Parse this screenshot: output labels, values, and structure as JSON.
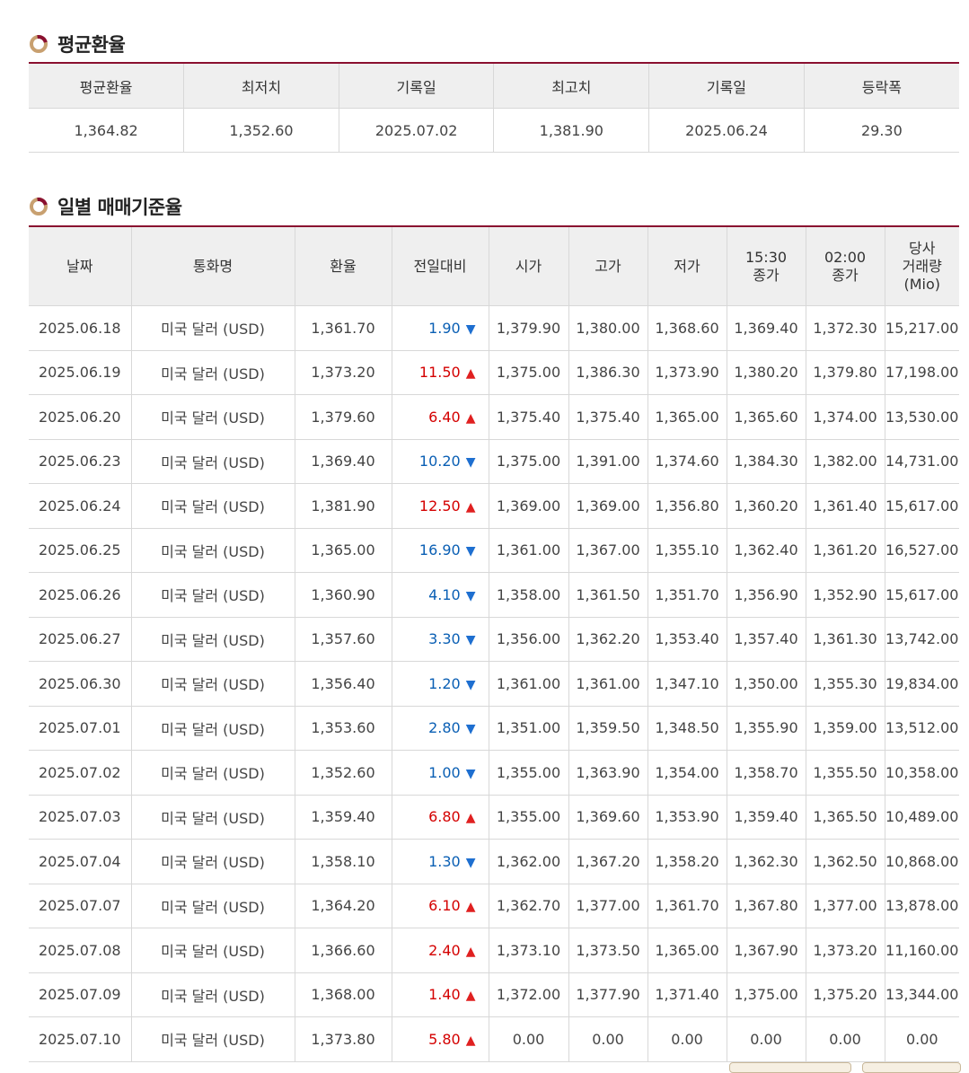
{
  "average_section": {
    "title": "평균환율",
    "headers": [
      "평균환율",
      "최저치",
      "기록일",
      "최고치",
      "기록일",
      "등락폭"
    ],
    "values": [
      "1,364.82",
      "1,352.60",
      "2025.07.02",
      "1,381.90",
      "2025.06.24",
      "29.30"
    ]
  },
  "daily_section": {
    "title": "일별 매매기준율",
    "headers": [
      "날짜",
      "통화명",
      "환율",
      "전일대비",
      "시가",
      "고가",
      "저가",
      "15:30\n종가",
      "02:00\n종가",
      "당사\n거래량\n(Mio)"
    ],
    "rows": [
      {
        "date": "2025.06.18",
        "currency": "미국 달러 (USD)",
        "rate": "1,361.70",
        "change": "1.90",
        "dir": "down",
        "open": "1,379.90",
        "high": "1,380.00",
        "low": "1,368.60",
        "close1530": "1,369.40",
        "close0200": "1,372.30",
        "volume": "15,217.00"
      },
      {
        "date": "2025.06.19",
        "currency": "미국 달러 (USD)",
        "rate": "1,373.20",
        "change": "11.50",
        "dir": "up",
        "open": "1,375.00",
        "high": "1,386.30",
        "low": "1,373.90",
        "close1530": "1,380.20",
        "close0200": "1,379.80",
        "volume": "17,198.00"
      },
      {
        "date": "2025.06.20",
        "currency": "미국 달러 (USD)",
        "rate": "1,379.60",
        "change": "6.40",
        "dir": "up",
        "open": "1,375.40",
        "high": "1,375.40",
        "low": "1,365.00",
        "close1530": "1,365.60",
        "close0200": "1,374.00",
        "volume": "13,530.00"
      },
      {
        "date": "2025.06.23",
        "currency": "미국 달러 (USD)",
        "rate": "1,369.40",
        "change": "10.20",
        "dir": "down",
        "open": "1,375.00",
        "high": "1,391.00",
        "low": "1,374.60",
        "close1530": "1,384.30",
        "close0200": "1,382.00",
        "volume": "14,731.00"
      },
      {
        "date": "2025.06.24",
        "currency": "미국 달러 (USD)",
        "rate": "1,381.90",
        "change": "12.50",
        "dir": "up",
        "open": "1,369.00",
        "high": "1,369.00",
        "low": "1,356.80",
        "close1530": "1,360.20",
        "close0200": "1,361.40",
        "volume": "15,617.00"
      },
      {
        "date": "2025.06.25",
        "currency": "미국 달러 (USD)",
        "rate": "1,365.00",
        "change": "16.90",
        "dir": "down",
        "open": "1,361.00",
        "high": "1,367.00",
        "low": "1,355.10",
        "close1530": "1,362.40",
        "close0200": "1,361.20",
        "volume": "16,527.00"
      },
      {
        "date": "2025.06.26",
        "currency": "미국 달러 (USD)",
        "rate": "1,360.90",
        "change": "4.10",
        "dir": "down",
        "open": "1,358.00",
        "high": "1,361.50",
        "low": "1,351.70",
        "close1530": "1,356.90",
        "close0200": "1,352.90",
        "volume": "15,617.00"
      },
      {
        "date": "2025.06.27",
        "currency": "미국 달러 (USD)",
        "rate": "1,357.60",
        "change": "3.30",
        "dir": "down",
        "open": "1,356.00",
        "high": "1,362.20",
        "low": "1,353.40",
        "close1530": "1,357.40",
        "close0200": "1,361.30",
        "volume": "13,742.00"
      },
      {
        "date": "2025.06.30",
        "currency": "미국 달러 (USD)",
        "rate": "1,356.40",
        "change": "1.20",
        "dir": "down",
        "open": "1,361.00",
        "high": "1,361.00",
        "low": "1,347.10",
        "close1530": "1,350.00",
        "close0200": "1,355.30",
        "volume": "19,834.00"
      },
      {
        "date": "2025.07.01",
        "currency": "미국 달러 (USD)",
        "rate": "1,353.60",
        "change": "2.80",
        "dir": "down",
        "open": "1,351.00",
        "high": "1,359.50",
        "low": "1,348.50",
        "close1530": "1,355.90",
        "close0200": "1,359.00",
        "volume": "13,512.00"
      },
      {
        "date": "2025.07.02",
        "currency": "미국 달러 (USD)",
        "rate": "1,352.60",
        "change": "1.00",
        "dir": "down",
        "open": "1,355.00",
        "high": "1,363.90",
        "low": "1,354.00",
        "close1530": "1,358.70",
        "close0200": "1,355.50",
        "volume": "10,358.00"
      },
      {
        "date": "2025.07.03",
        "currency": "미국 달러 (USD)",
        "rate": "1,359.40",
        "change": "6.80",
        "dir": "up",
        "open": "1,355.00",
        "high": "1,369.60",
        "low": "1,353.90",
        "close1530": "1,359.40",
        "close0200": "1,365.50",
        "volume": "10,489.00"
      },
      {
        "date": "2025.07.04",
        "currency": "미국 달러 (USD)",
        "rate": "1,358.10",
        "change": "1.30",
        "dir": "down",
        "open": "1,362.00",
        "high": "1,367.20",
        "low": "1,358.20",
        "close1530": "1,362.30",
        "close0200": "1,362.50",
        "volume": "10,868.00"
      },
      {
        "date": "2025.07.07",
        "currency": "미국 달러 (USD)",
        "rate": "1,364.20",
        "change": "6.10",
        "dir": "up",
        "open": "1,362.70",
        "high": "1,377.00",
        "low": "1,361.70",
        "close1530": "1,367.80",
        "close0200": "1,377.00",
        "volume": "13,878.00"
      },
      {
        "date": "2025.07.08",
        "currency": "미국 달러 (USD)",
        "rate": "1,366.60",
        "change": "2.40",
        "dir": "up",
        "open": "1,373.10",
        "high": "1,373.50",
        "low": "1,365.00",
        "close1530": "1,367.90",
        "close0200": "1,373.20",
        "volume": "11,160.00"
      },
      {
        "date": "2025.07.09",
        "currency": "미국 달러 (USD)",
        "rate": "1,368.00",
        "change": "1.40",
        "dir": "up",
        "open": "1,372.00",
        "high": "1,377.90",
        "low": "1,371.40",
        "close1530": "1,375.00",
        "close0200": "1,375.20",
        "volume": "13,344.00"
      },
      {
        "date": "2025.07.10",
        "currency": "미국 달러 (USD)",
        "rate": "1,373.80",
        "change": "5.80",
        "dir": "up",
        "open": "0.00",
        "high": "0.00",
        "low": "0.00",
        "close1530": "0.00",
        "close0200": "0.00",
        "volume": "0.00"
      }
    ]
  },
  "icons": {
    "section": "ring-bullet-icon",
    "up": "triangle-up-icon",
    "down": "triangle-down-icon"
  },
  "colors": {
    "accent_line": "#8a1030",
    "up": "#d40000",
    "down": "#0a5fb4",
    "header_bg": "#efefef"
  }
}
